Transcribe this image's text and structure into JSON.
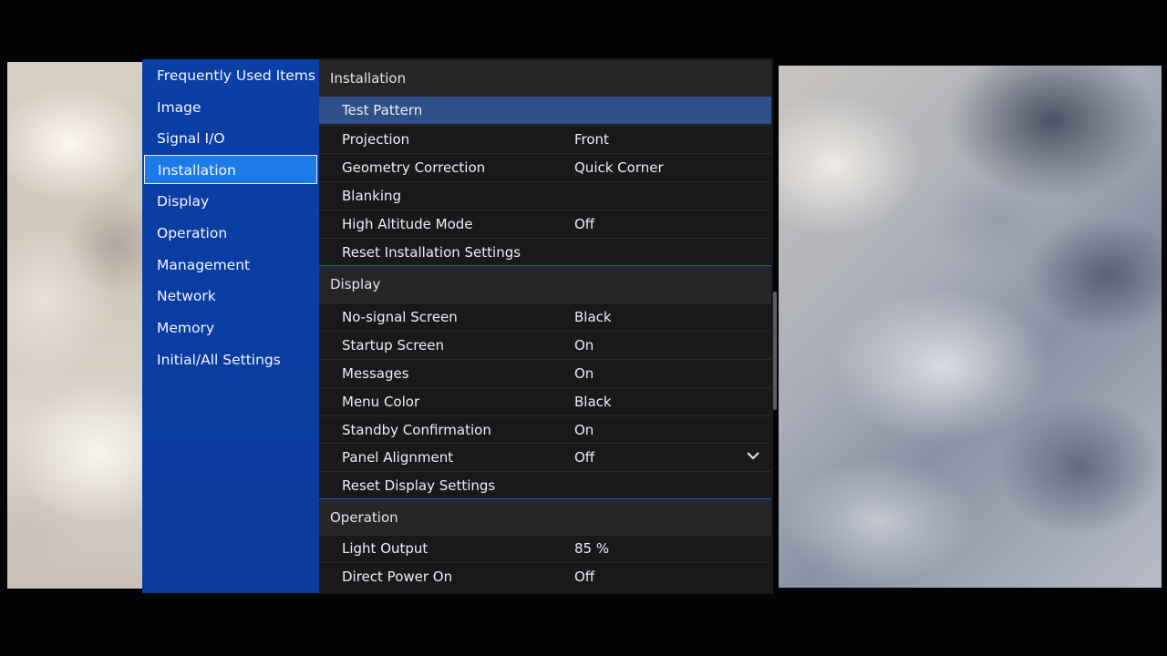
{
  "sidebar": {
    "items": [
      {
        "label": "Frequently Used Items"
      },
      {
        "label": "Image"
      },
      {
        "label": "Signal I/O"
      },
      {
        "label": "Installation"
      },
      {
        "label": "Display"
      },
      {
        "label": "Operation"
      },
      {
        "label": "Management"
      },
      {
        "label": "Network"
      },
      {
        "label": "Memory"
      },
      {
        "label": "Initial/All Settings"
      }
    ],
    "active_index": 3
  },
  "sections": {
    "installation": {
      "title": "Installation",
      "rows": [
        {
          "label": "Test Pattern",
          "value": ""
        },
        {
          "label": "Projection",
          "value": "Front"
        },
        {
          "label": "Geometry Correction",
          "value": "Quick Corner"
        },
        {
          "label": "Blanking",
          "value": ""
        },
        {
          "label": "High Altitude Mode",
          "value": "Off"
        },
        {
          "label": "Reset Installation Settings",
          "value": ""
        }
      ]
    },
    "display": {
      "title": "Display",
      "rows": [
        {
          "label": "No-signal Screen",
          "value": "Black"
        },
        {
          "label": "Startup Screen",
          "value": "On"
        },
        {
          "label": "Messages",
          "value": "On"
        },
        {
          "label": "Menu Color",
          "value": "Black"
        },
        {
          "label": "Standby Confirmation",
          "value": "On"
        },
        {
          "label": "Panel Alignment",
          "value": "Off"
        },
        {
          "label": "Reset Display Settings",
          "value": ""
        }
      ]
    },
    "operation": {
      "title": "Operation",
      "rows": [
        {
          "label": "Light Output",
          "value": "85 %"
        },
        {
          "label": "Direct Power On",
          "value": "Off"
        }
      ]
    }
  },
  "colors": {
    "sidebar_bg": "#0b3ea3",
    "active_item": "#1d7be9",
    "selected_row": "#2f4f88",
    "content_bg": "#19191b"
  },
  "icons": [
    "chevron-down-icon"
  ]
}
